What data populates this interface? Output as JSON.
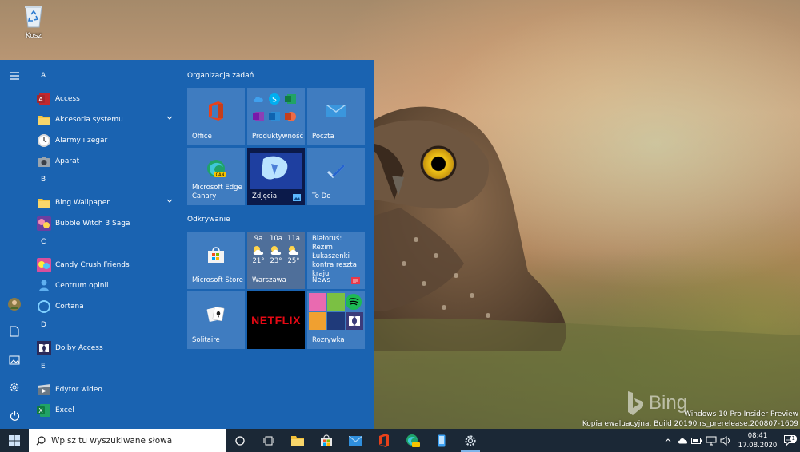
{
  "desktop": {
    "recycle_bin_label": "Kosz",
    "bing_label": "Bing",
    "watermark_line1": "Windows 10 Pro Insider Preview",
    "watermark_line2": "Kopia ewaluacyjna. Build 20190.rs_prerelease.200807-1609"
  },
  "start_menu": {
    "app_list": [
      {
        "type": "letter",
        "label": "A"
      },
      {
        "type": "app",
        "label": "Access",
        "icon": "access-icon"
      },
      {
        "type": "app",
        "label": "Akcesoria systemu",
        "icon": "folder-icon",
        "expandable": true
      },
      {
        "type": "app",
        "label": "Alarmy i zegar",
        "icon": "clock-icon"
      },
      {
        "type": "app",
        "label": "Aparat",
        "icon": "camera-icon"
      },
      {
        "type": "letter",
        "label": "B"
      },
      {
        "type": "app",
        "label": "Bing Wallpaper",
        "icon": "folder-icon",
        "expandable": true
      },
      {
        "type": "app",
        "label": "Bubble Witch 3 Saga",
        "icon": "game-icon"
      },
      {
        "type": "letter",
        "label": "C"
      },
      {
        "type": "app",
        "label": "Candy Crush Friends",
        "icon": "game-icon"
      },
      {
        "type": "app",
        "label": "Centrum opinii",
        "icon": "person-icon"
      },
      {
        "type": "app",
        "label": "Cortana",
        "icon": "cortana-icon"
      },
      {
        "type": "letter",
        "label": "D"
      },
      {
        "type": "app",
        "label": "Dolby Access",
        "icon": "dolby-icon"
      },
      {
        "type": "letter",
        "label": "E"
      },
      {
        "type": "app",
        "label": "Edytor wideo",
        "icon": "video-editor-icon"
      },
      {
        "type": "app",
        "label": "Excel",
        "icon": "excel-icon"
      }
    ],
    "groups": {
      "group1_title": "Organizacja zadań",
      "group2_title": "Odkrywanie"
    },
    "tiles": {
      "office": "Office",
      "productivity": "Produktywność",
      "mail": "Poczta",
      "edge": "Microsoft Edge Canary",
      "photos": "Zdjęcia",
      "todo": "To Do",
      "store": "Microsoft Store",
      "weather_city": "Warszawa",
      "weather": [
        {
          "hour": "9a",
          "temp": "21°"
        },
        {
          "hour": "10a",
          "temp": "23°"
        },
        {
          "hour": "11a",
          "temp": "25°"
        }
      ],
      "news_headline": "Białoruś: Reżim Łukaszenki kontra reszta kraju",
      "news_label": "News",
      "solitaire": "Solitaire",
      "netflix": "NETFLIX",
      "play": "Rozrywka",
      "edge_badge": "CAN"
    }
  },
  "taskbar": {
    "search_placeholder": "Wpisz tu wyszukiwane słowa",
    "clock_time": "08:41",
    "clock_date": "17.08.2020",
    "notification_count": "1"
  },
  "colors": {
    "start_bg": "#1a63b1",
    "tile_bg": "#3f7cc0",
    "taskbar_bg": "#1b2836"
  }
}
